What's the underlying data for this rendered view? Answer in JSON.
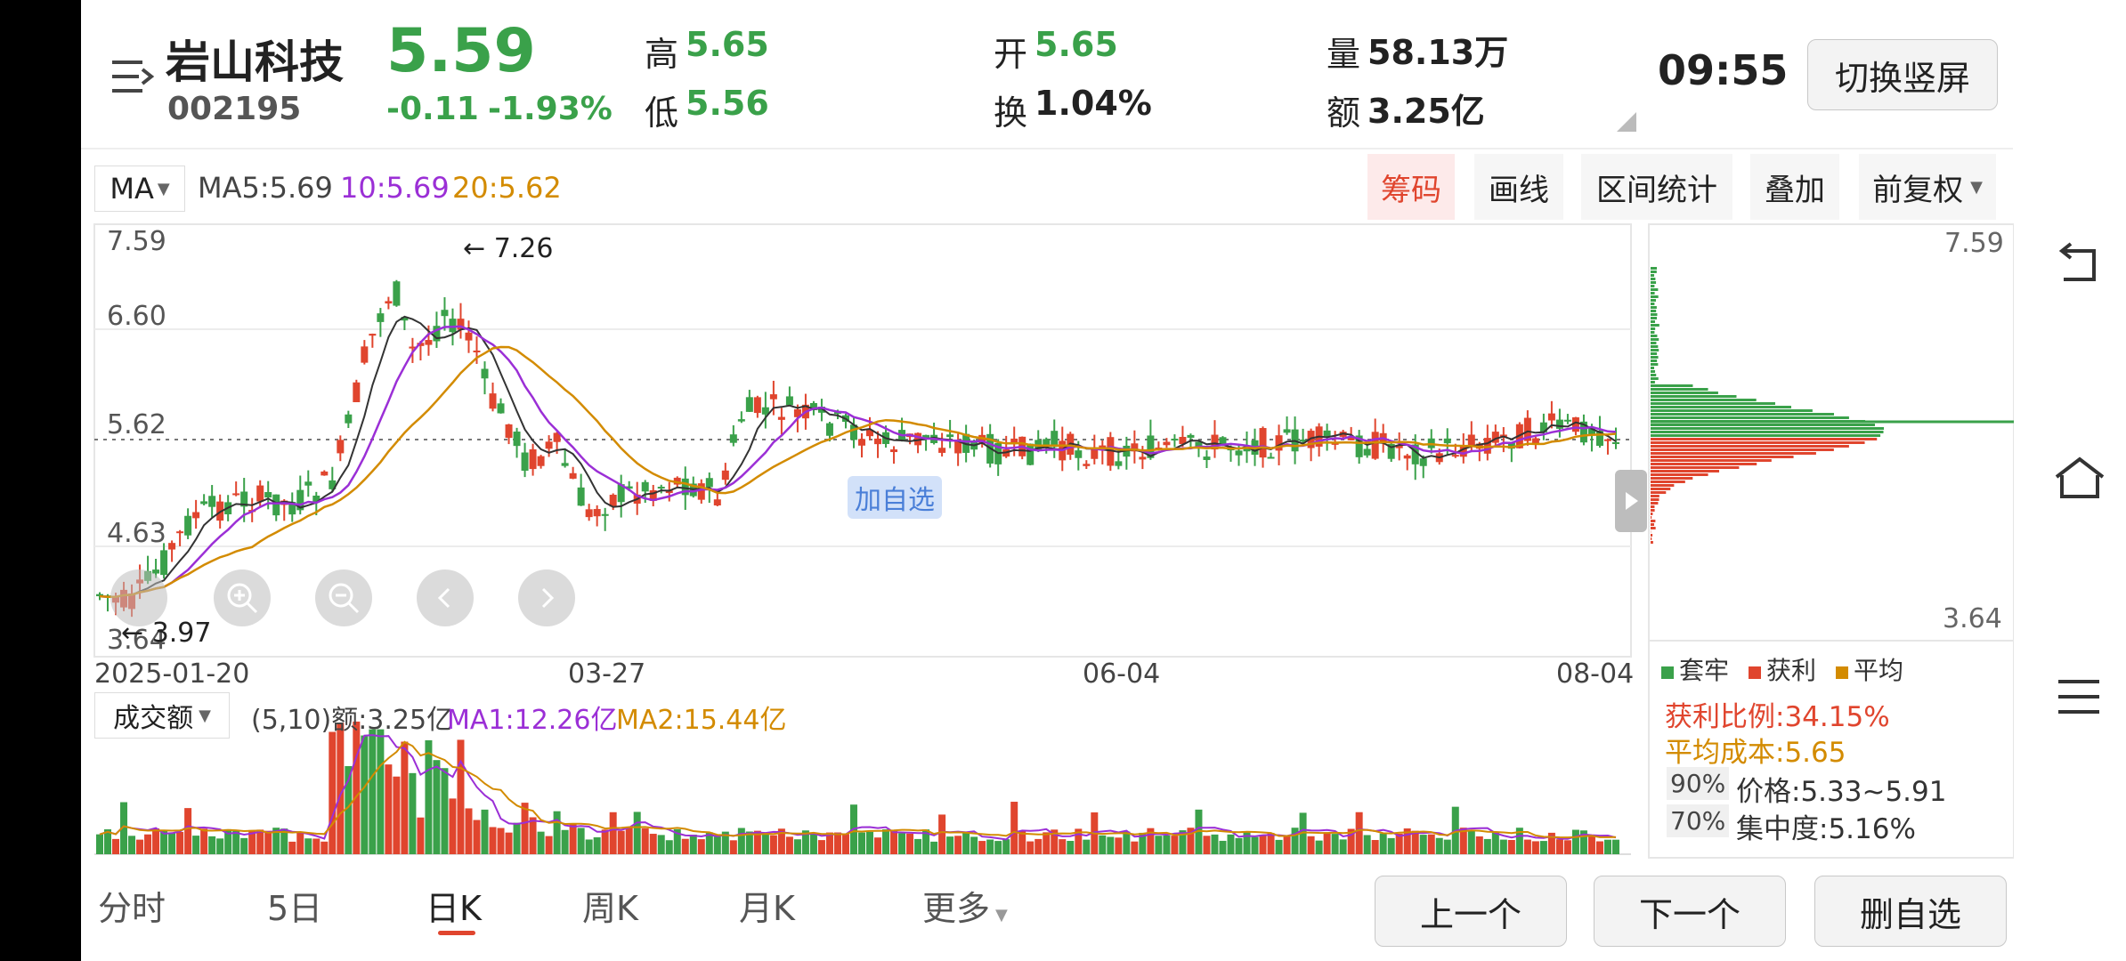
{
  "stock": {
    "name": "岩山科技",
    "code": "002195",
    "price": "5.59",
    "change": "-0.11",
    "change_pct": "-1.93%"
  },
  "quote": {
    "high_label": "高",
    "high": "5.65",
    "low_label": "低",
    "low": "5.56",
    "open_label": "开",
    "open": "5.65",
    "turnover_label": "换",
    "turnover": "1.04%",
    "volume_label": "量",
    "volume": "58.13万",
    "amount_label": "额",
    "amount": "3.25亿"
  },
  "time": "09:55",
  "switch_button": "切换竖屏",
  "indicator": {
    "name": "MA",
    "ma5": "MA5:5.69",
    "ma10": "10:5.69",
    "ma20": "20:5.62",
    "colors": {
      "ma5": "#333333",
      "ma10": "#9b2fd6",
      "ma20": "#d38b00",
      "up": "#e0452e",
      "down": "#3aa14a"
    }
  },
  "toolbar": [
    "筹码",
    "画线",
    "区间统计",
    "叠加",
    "前复权"
  ],
  "chart_data": {
    "type": "candlestick",
    "price_axis": [
      "7.59",
      "6.60",
      "5.62",
      "4.63",
      "3.64"
    ],
    "dates": [
      "2025-01-20",
      "03-27",
      "06-04",
      "08-04"
    ],
    "max_label": "7.26",
    "min_label": "3.97",
    "ylim": [
      3.64,
      7.59
    ],
    "last_price": 5.59
  },
  "add_watch_label": "加自选",
  "volume_panel": {
    "name": "成交额",
    "params": "(5,10)额:3.25亿",
    "ma1": "MA1:12.26亿",
    "ma2": "MA2:15.44亿"
  },
  "chip": {
    "top": "7.59",
    "bottom": "3.64",
    "legend": [
      "套牢",
      "获利",
      "平均"
    ],
    "profit_ratio": "获利比例:34.15%",
    "avg_cost": "平均成本:5.65",
    "row90_tag": "90%",
    "row90": "价格:5.33~5.91",
    "row70_tag": "70%",
    "row70": "集中度:5.16%"
  },
  "tabs": [
    "分时",
    "5日",
    "日K",
    "周K",
    "月K",
    "更多"
  ],
  "actions": [
    "上一个",
    "下一个",
    "删自选"
  ]
}
